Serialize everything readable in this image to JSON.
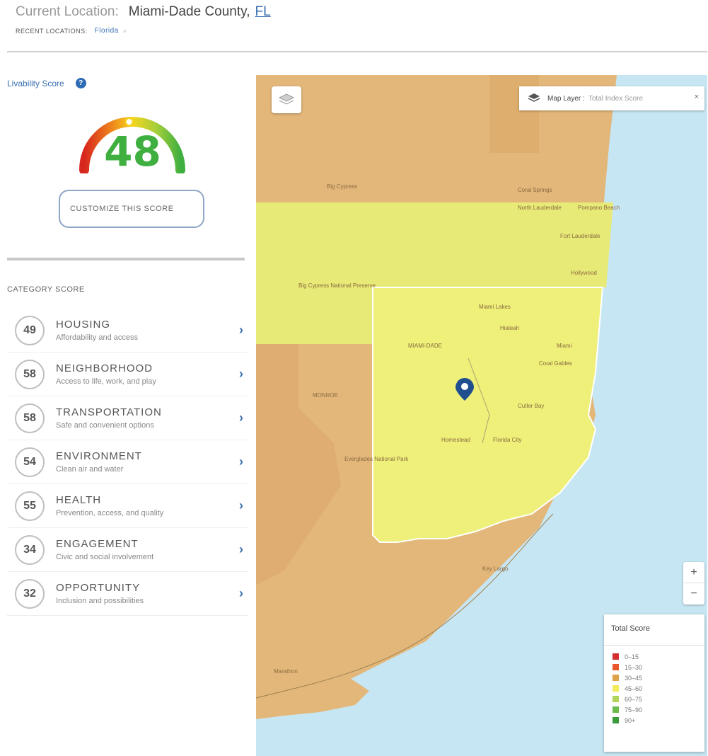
{
  "header": {
    "current_location_label": "Current Location:",
    "county": "Miami-Dade County,",
    "state": "FL",
    "recent_label": "RECENT LOCATIONS:",
    "recent_item": "Florida",
    "recent_remove": "×"
  },
  "sidebar": {
    "score_title": "Livability Score",
    "info_icon": "?",
    "score": "48",
    "score_value": 48,
    "customize_label": "CUSTOMIZE THIS SCORE",
    "category_title": "CATEGORY SCORE",
    "categories": [
      {
        "score": "49",
        "name": "HOUSING",
        "desc": "Affordability and access"
      },
      {
        "score": "58",
        "name": "NEIGHBORHOOD",
        "desc": "Access to life, work, and play"
      },
      {
        "score": "58",
        "name": "TRANSPORTATION",
        "desc": "Safe and convenient options"
      },
      {
        "score": "54",
        "name": "ENVIRONMENT",
        "desc": "Clean air and water"
      },
      {
        "score": "55",
        "name": "HEALTH",
        "desc": "Prevention, access, and quality"
      },
      {
        "score": "34",
        "name": "ENGAGEMENT",
        "desc": "Civic and social involvement"
      },
      {
        "score": "32",
        "name": "OPPORTUNITY",
        "desc": "Inclusion and possibilities"
      }
    ],
    "chevron": "›"
  },
  "map": {
    "layer_label": "Map Layer :",
    "layer_value": "Total Index Score",
    "layer_close": "×",
    "zoom_in": "+",
    "zoom_out": "−",
    "legend_title": "Total Score",
    "legend": [
      {
        "label": "0–15",
        "color": "#d32f2f"
      },
      {
        "label": "15–30",
        "color": "#e8562a"
      },
      {
        "label": "30–45",
        "color": "#dea24a"
      },
      {
        "label": "45–60",
        "color": "#f2ec5a"
      },
      {
        "label": "60–75",
        "color": "#b3d35a"
      },
      {
        "label": "75–90",
        "color": "#6cbb4e"
      },
      {
        "label": "90+",
        "color": "#3a9a3a"
      }
    ],
    "places": [
      "Big Cypress National Preserve",
      "North Lauderdale",
      "Pompano Beach",
      "Coral Springs",
      "Fort Lauderdale",
      "Hollywood",
      "Miami Lakes",
      "Hialeah",
      "Miami",
      "Coral Gables",
      "Cutler Bay",
      "Homestead",
      "Florida City",
      "Everglades National Park",
      "Key Largo",
      "Marathon",
      "MIAMI-DADE",
      "MONROE"
    ]
  },
  "colors": {
    "accent": "#3a6fb0",
    "score_green": "#3faf3f",
    "water": "#c7e6f3",
    "map_orange": "#e3b77a",
    "map_yellow": "#eef07a"
  }
}
